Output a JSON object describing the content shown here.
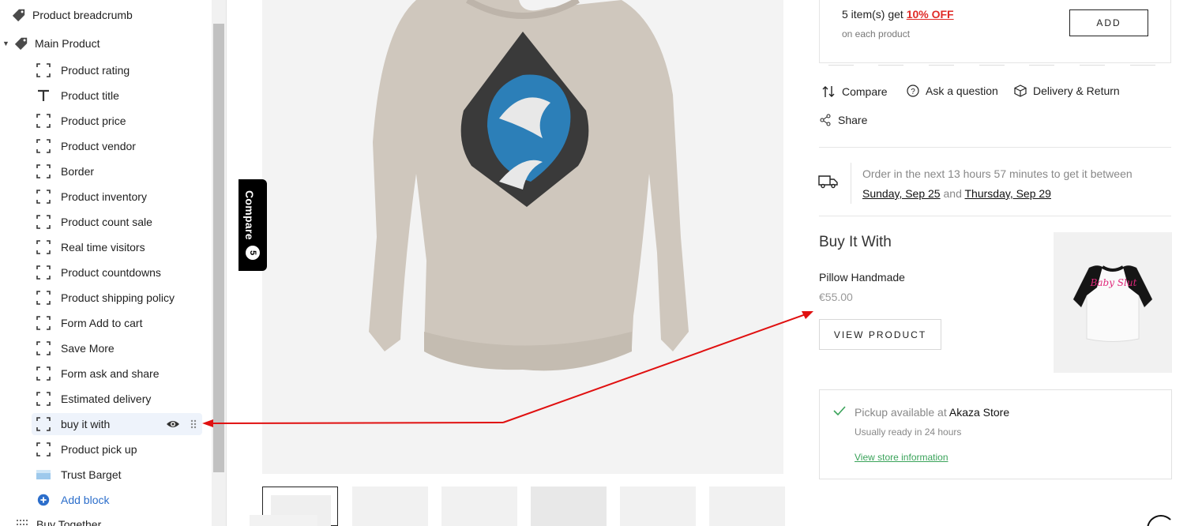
{
  "sidebar": {
    "sections": [
      {
        "label": "Product breadcrumb"
      },
      {
        "label": "Main Product"
      }
    ],
    "blocks": [
      {
        "label": "Product rating",
        "icon": "dashed-square-icon"
      },
      {
        "label": "Product title",
        "icon": "text-t-icon"
      },
      {
        "label": "Product price",
        "icon": "dashed-square-icon"
      },
      {
        "label": "Product vendor",
        "icon": "dashed-square-icon"
      },
      {
        "label": "Border",
        "icon": "dashed-square-icon"
      },
      {
        "label": "Product inventory",
        "icon": "dashed-square-icon"
      },
      {
        "label": "Product count sale",
        "icon": "dashed-square-icon"
      },
      {
        "label": "Real time visitors",
        "icon": "dashed-square-icon"
      },
      {
        "label": "Product countdowns",
        "icon": "dashed-square-icon"
      },
      {
        "label": "Product shipping policy",
        "icon": "dashed-square-icon"
      },
      {
        "label": "Form Add to cart",
        "icon": "dashed-square-icon"
      },
      {
        "label": "Save More",
        "icon": "dashed-square-icon"
      },
      {
        "label": "Form ask and share",
        "icon": "dashed-square-icon"
      },
      {
        "label": "Estimated delivery",
        "icon": "dashed-square-icon"
      },
      {
        "label": "buy it with",
        "icon": "dashed-square-icon",
        "active": true
      },
      {
        "label": "Product pick up",
        "icon": "dashed-square-icon"
      },
      {
        "label": "Trust Barget",
        "icon": "image-icon"
      }
    ],
    "add_block": "Add block",
    "next_section": "Buy Together"
  },
  "compare_tab": {
    "label": "Compare",
    "count": "5"
  },
  "offer": {
    "prefix": "5 item(s) get ",
    "discount": "10% OFF",
    "sub": "on each product",
    "add_label": "ADD"
  },
  "actions": {
    "compare": "Compare",
    "ask": "Ask a question",
    "delivery_return": "Delivery & Return",
    "share": "Share"
  },
  "delivery": {
    "line1": "Order in the next 13 hours 57 minutes to get it between",
    "date1": "Sunday, Sep 25",
    "and": " and ",
    "date2": "Thursday, Sep 29"
  },
  "buy_it_with": {
    "title": "Buy It With",
    "product_name": "Pillow Handmade",
    "price": "€55.00",
    "button": "VIEW PRODUCT",
    "shirt_text": "Baby Slut"
  },
  "pickup": {
    "prefix": "Pickup available at ",
    "store": "Akaza Store",
    "ready": "Usually ready in 24 hours",
    "link": "View store information"
  },
  "colors": {
    "accent_blue": "#2c6ecb",
    "sale_red": "#e02b27",
    "pickup_green": "#3aa35a",
    "arrow_red": "#e01010"
  }
}
